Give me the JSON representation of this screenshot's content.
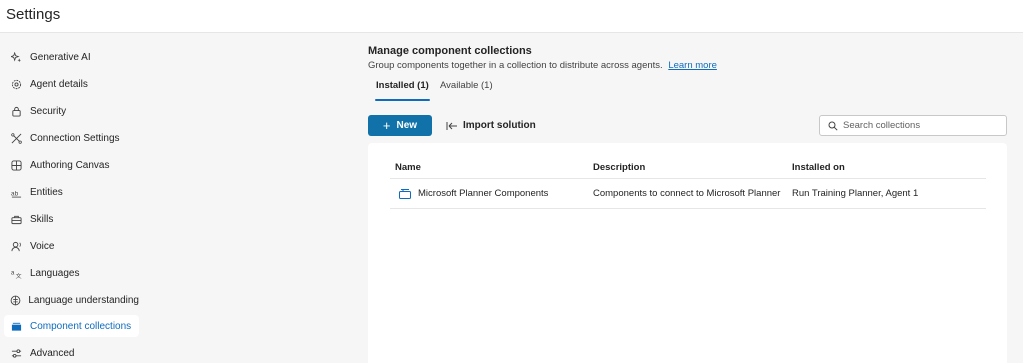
{
  "app": {
    "title": "Settings"
  },
  "sidebar": {
    "items": [
      {
        "label": "Generative AI",
        "icon": "sparkle-icon",
        "selected": false
      },
      {
        "label": "Agent details",
        "icon": "gear-icon",
        "selected": false
      },
      {
        "label": "Security",
        "icon": "lock-icon",
        "selected": false
      },
      {
        "label": "Connection Settings",
        "icon": "connection-icon",
        "selected": false
      },
      {
        "label": "Authoring Canvas",
        "icon": "canvas-icon",
        "selected": false
      },
      {
        "label": "Entities",
        "icon": "entities-icon",
        "selected": false
      },
      {
        "label": "Skills",
        "icon": "skills-icon",
        "selected": false
      },
      {
        "label": "Voice",
        "icon": "voice-icon",
        "selected": false
      },
      {
        "label": "Languages",
        "icon": "languages-icon",
        "selected": false
      },
      {
        "label": "Language understanding",
        "icon": "brain-icon",
        "selected": false
      },
      {
        "label": "Component collections",
        "icon": "collection-icon",
        "selected": true
      },
      {
        "label": "Advanced",
        "icon": "sliders-icon",
        "selected": false
      }
    ]
  },
  "main": {
    "heading": "Manage component collections",
    "subheading": "Group components together in a collection to distribute across agents.",
    "learn_more": "Learn more",
    "tabs": [
      {
        "label": "Installed (1)",
        "active": true
      },
      {
        "label": "Available (1)",
        "active": false
      }
    ],
    "toolbar": {
      "new_label": "New",
      "import_label": "Import solution"
    },
    "search": {
      "placeholder": "Search collections",
      "value": ""
    },
    "table": {
      "columns": [
        "Name",
        "Description",
        "Installed on"
      ],
      "rows": [
        {
          "name": "Microsoft Planner Components",
          "description": "Components to connect to Microsoft Planner",
          "installed_on": "Run Training Planner, Agent 1",
          "icon": "collection-icon"
        }
      ]
    }
  },
  "colors": {
    "accent": "#0f6cbd",
    "primary_button": "#1072a8",
    "background": "#f6f6f6",
    "surface": "#ffffff"
  }
}
